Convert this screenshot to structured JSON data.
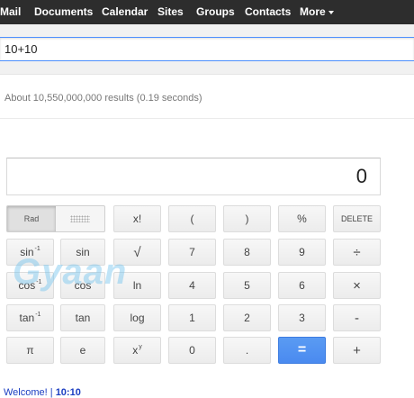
{
  "nav": {
    "items": [
      "Mail",
      "Documents",
      "Calendar",
      "Sites",
      "Groups",
      "Contacts"
    ],
    "more": "More"
  },
  "search": {
    "query": "10+10"
  },
  "results": {
    "stats": "About 10,550,000,000 results (0.19 seconds)"
  },
  "calculator": {
    "display": "0",
    "mode": {
      "rad_label": "Rad",
      "selected": "Rad"
    },
    "keys": {
      "factorial": "x!",
      "open_paren": "(",
      "close_paren": ")",
      "percent": "%",
      "delete": "DELETE",
      "sin_inverse": "sin",
      "sin": "sin",
      "sqrt": "√",
      "seven": "7",
      "eight": "8",
      "nine": "9",
      "divide": "÷",
      "cos_inverse": "cos",
      "cos": "cos",
      "ln": "ln",
      "four": "4",
      "five": "5",
      "six": "6",
      "multiply": "×",
      "tan_inverse": "tan",
      "tan": "tan",
      "log": "log",
      "one": "1",
      "two": "2",
      "three": "3",
      "subtract": "-",
      "pi": "π",
      "e": "e",
      "power": "x",
      "zero": "0",
      "decimal": ".",
      "equals": "=",
      "add": "+"
    },
    "superscripts": {
      "inverse": "-1",
      "power": "y"
    }
  },
  "watermark": "Gyaan",
  "footer": {
    "welcome": "Welcome!",
    "separator": "|",
    "time": "10:10"
  }
}
